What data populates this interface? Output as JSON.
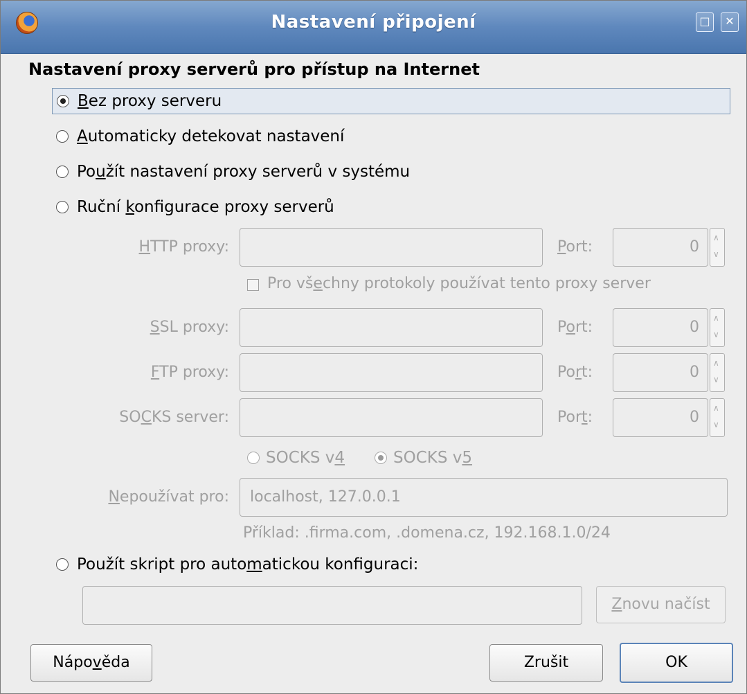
{
  "window": {
    "title": "Nastavení připojení"
  },
  "heading": "Nastavení proxy serverů pro přístup na Internet",
  "options": [
    {
      "label": "Bez proxy serveru",
      "checked": true
    },
    {
      "label": "Automaticky detekovat nastavení",
      "checked": false
    },
    {
      "label": "Použít nastavení proxy serverů v systému",
      "checked": false
    },
    {
      "label": "Ruční konfigurace proxy serverů",
      "checked": false
    }
  ],
  "manual": {
    "http_label": "HTTP proxy:",
    "ssl_label": "SSL proxy:",
    "ftp_label": "FTP proxy:",
    "socks_label": "SOCKS server:",
    "port_label": "Port:",
    "http_port": "0",
    "ssl_port": "0",
    "ftp_port": "0",
    "socks_port": "0",
    "share_all_label": "Pro všechny protokoly používat tento proxy server",
    "socks_v4": "SOCKS v4",
    "socks_v5": "SOCKS v5",
    "no_proxy_label": "Nepoužívat pro:",
    "no_proxy_value": "localhost, 127.0.0.1",
    "example": "Příklad: .firma.com, .domena.cz, 192.168.1.0/24"
  },
  "auto_config": {
    "label": "Použít skript pro automatickou konfiguraci:",
    "reload_button": "Znovu načíst",
    "url_value": ""
  },
  "buttons": {
    "help": "Nápověda",
    "cancel": "Zrušit",
    "ok": "OK"
  }
}
